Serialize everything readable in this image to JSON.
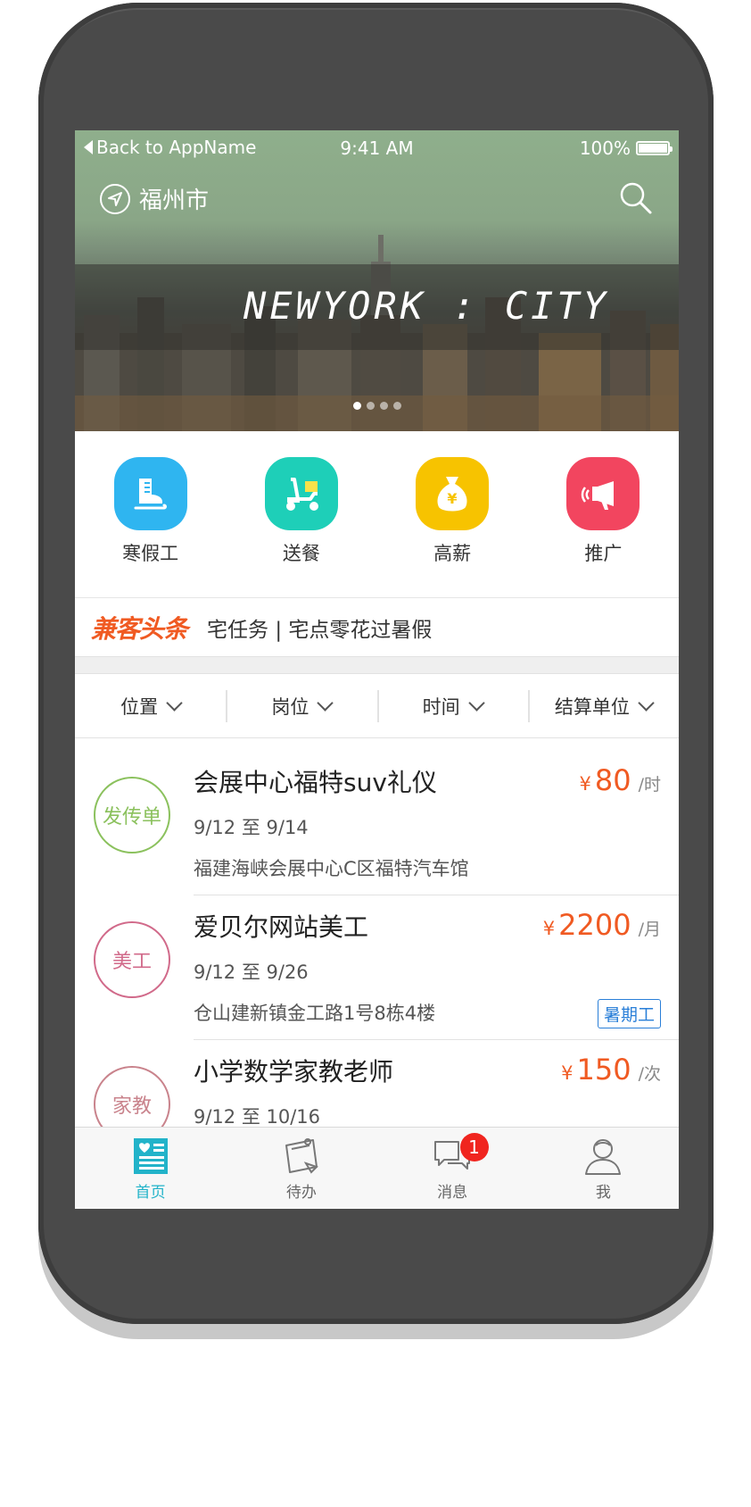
{
  "status_bar": {
    "back": "Back to AppName",
    "time": "9:41 AM",
    "battery": "100%"
  },
  "header": {
    "city": "福州市"
  },
  "banner": {
    "text": "NEWYORK : CITY",
    "page_count": 4,
    "active_page": 1
  },
  "categories": [
    {
      "label": "寒假工",
      "icon": "ice-skate-icon",
      "color": "#2fb5f0"
    },
    {
      "label": "送餐",
      "icon": "scooter-icon",
      "color": "#1ecfb8"
    },
    {
      "label": "高薪",
      "icon": "money-bag-icon",
      "color": "#f7c300"
    },
    {
      "label": "推广",
      "icon": "megaphone-icon",
      "color": "#f2455f"
    }
  ],
  "news": {
    "logo": "兼客头条",
    "headline": "宅任务 | 宅点零花过暑假"
  },
  "filters": [
    "位置",
    "岗位",
    "时间",
    "结算单位"
  ],
  "listings": [
    {
      "badge": "发传单",
      "badge_color": "#8bc15d",
      "title": "会展中心福特suv礼仪",
      "date": "9/12 至 9/14",
      "address": "福建海峡会展中心C区福特汽车馆",
      "currency": "¥",
      "price": "80",
      "unit": "/时",
      "tag": ""
    },
    {
      "badge": "美工",
      "badge_color": "#d16a8a",
      "title": "爱贝尔网站美工",
      "date": "9/12 至 9/26",
      "address": "仓山建新镇金工路1号8栋4楼",
      "currency": "¥",
      "price": "2200",
      "unit": "/月",
      "tag": "暑期工"
    },
    {
      "badge": "家教",
      "badge_color": "#c9838c",
      "title": "小学数学家教老师",
      "date": "9/12 至 10/16",
      "address": "",
      "currency": "¥",
      "price": "150",
      "unit": "/次",
      "tag": ""
    }
  ],
  "tabs": [
    {
      "label": "首页",
      "icon": "home-news-icon",
      "active": true
    },
    {
      "label": "待办",
      "icon": "todo-board-icon",
      "active": false
    },
    {
      "label": "消息",
      "icon": "chat-bubbles-icon",
      "active": false,
      "badge": "1"
    },
    {
      "label": "我",
      "icon": "user-icon",
      "active": false
    }
  ],
  "colors": {
    "accent": "#22b3c9",
    "price": "#f05a22",
    "tag": "#2a7fd8"
  }
}
